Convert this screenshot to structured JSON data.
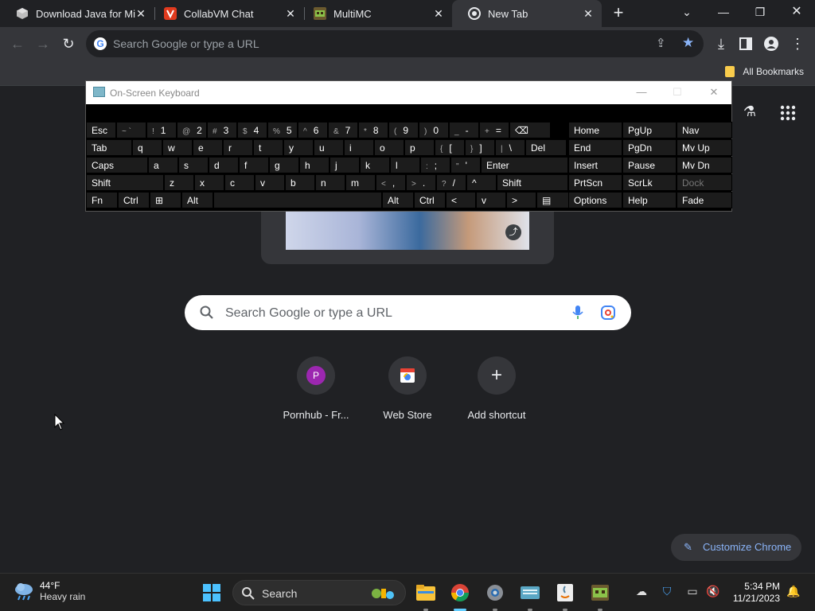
{
  "tabs": [
    {
      "title": "Download Java for Mi",
      "favicon": "java-cube-icon"
    },
    {
      "title": "CollabVM Chat",
      "favicon": "vivaldi-v-icon"
    },
    {
      "title": "MultiMC",
      "favicon": "multimc-icon"
    },
    {
      "title": "New Tab",
      "favicon": "chrome-icon",
      "active": true
    }
  ],
  "omnibox": {
    "placeholder": "Search Google or type a URL"
  },
  "bookmarks": {
    "all_label": "All Bookmarks"
  },
  "osk": {
    "title": "On-Screen Keyboard",
    "rows": [
      [
        {
          "k": "Esc"
        },
        {
          "s": "~ `",
          "k": ""
        },
        {
          "s": "!",
          "k": "1"
        },
        {
          "s": "@",
          "k": "2"
        },
        {
          "s": "#",
          "k": "3"
        },
        {
          "s": "$",
          "k": "4"
        },
        {
          "s": "%",
          "k": "5"
        },
        {
          "s": "^",
          "k": "6"
        },
        {
          "s": "&",
          "k": "7"
        },
        {
          "s": "*",
          "k": "8"
        },
        {
          "s": "(",
          "k": "9"
        },
        {
          "s": ")",
          "k": "0"
        },
        {
          "s": "_",
          "k": "-"
        },
        {
          "s": "+",
          "k": "="
        },
        {
          "k": "⌫"
        }
      ],
      [
        {
          "k": "Tab"
        },
        {
          "k": "q"
        },
        {
          "k": "w"
        },
        {
          "k": "e"
        },
        {
          "k": "r"
        },
        {
          "k": "t"
        },
        {
          "k": "y"
        },
        {
          "k": "u"
        },
        {
          "k": "i"
        },
        {
          "k": "o"
        },
        {
          "k": "p"
        },
        {
          "s": "{",
          "k": "["
        },
        {
          "s": "}",
          "k": "]"
        },
        {
          "s": "|",
          "k": "\\"
        },
        {
          "k": "Del"
        }
      ],
      [
        {
          "k": "Caps"
        },
        {
          "k": "a"
        },
        {
          "k": "s"
        },
        {
          "k": "d"
        },
        {
          "k": "f"
        },
        {
          "k": "g"
        },
        {
          "k": "h"
        },
        {
          "k": "j"
        },
        {
          "k": "k"
        },
        {
          "k": "l"
        },
        {
          "s": ":",
          "k": ";"
        },
        {
          "s": "\"",
          "k": "'"
        },
        {
          "k": "Enter"
        }
      ],
      [
        {
          "k": "Shift"
        },
        {
          "k": "z"
        },
        {
          "k": "x"
        },
        {
          "k": "c"
        },
        {
          "k": "v"
        },
        {
          "k": "b"
        },
        {
          "k": "n"
        },
        {
          "k": "m"
        },
        {
          "s": "<",
          "k": ","
        },
        {
          "s": ">",
          "k": "."
        },
        {
          "s": "?",
          "k": "/"
        },
        {
          "k": "^"
        },
        {
          "k": "Shift"
        }
      ],
      [
        {
          "k": "Fn"
        },
        {
          "k": "Ctrl"
        },
        {
          "k": "⊞"
        },
        {
          "k": "Alt"
        },
        {
          "k": ""
        },
        {
          "k": "Alt"
        },
        {
          "k": "Ctrl"
        },
        {
          "k": "<"
        },
        {
          "k": "v"
        },
        {
          "k": ">"
        },
        {
          "k": "▤"
        }
      ]
    ],
    "nav": [
      [
        "Home",
        "PgUp",
        "Nav"
      ],
      [
        "End",
        "PgDn",
        "Mv Up"
      ],
      [
        "Insert",
        "Pause",
        "Mv Dn"
      ],
      [
        "PrtScn",
        "ScrLk",
        "Dock"
      ],
      [
        "Options",
        "Help",
        "Fade"
      ]
    ]
  },
  "search": {
    "placeholder": "Search Google or type a URL"
  },
  "shortcuts": [
    {
      "label": "Pornhub - Fr...",
      "icon_letter": "P",
      "icon_color": "#9c27b0"
    },
    {
      "label": "Web Store",
      "icon": "webstore-icon"
    },
    {
      "label": "Add shortcut",
      "icon": "plus-icon"
    }
  ],
  "customize": {
    "label": "Customize Chrome"
  },
  "taskbar": {
    "weather_temp": "44°F",
    "weather_desc": "Heavy rain",
    "search_label": "Search",
    "time": "5:34 PM",
    "date": "11/21/2023"
  },
  "colors": {
    "accent": "#8ab4f8",
    "bg": "#202124",
    "toolbar": "#35363a"
  }
}
